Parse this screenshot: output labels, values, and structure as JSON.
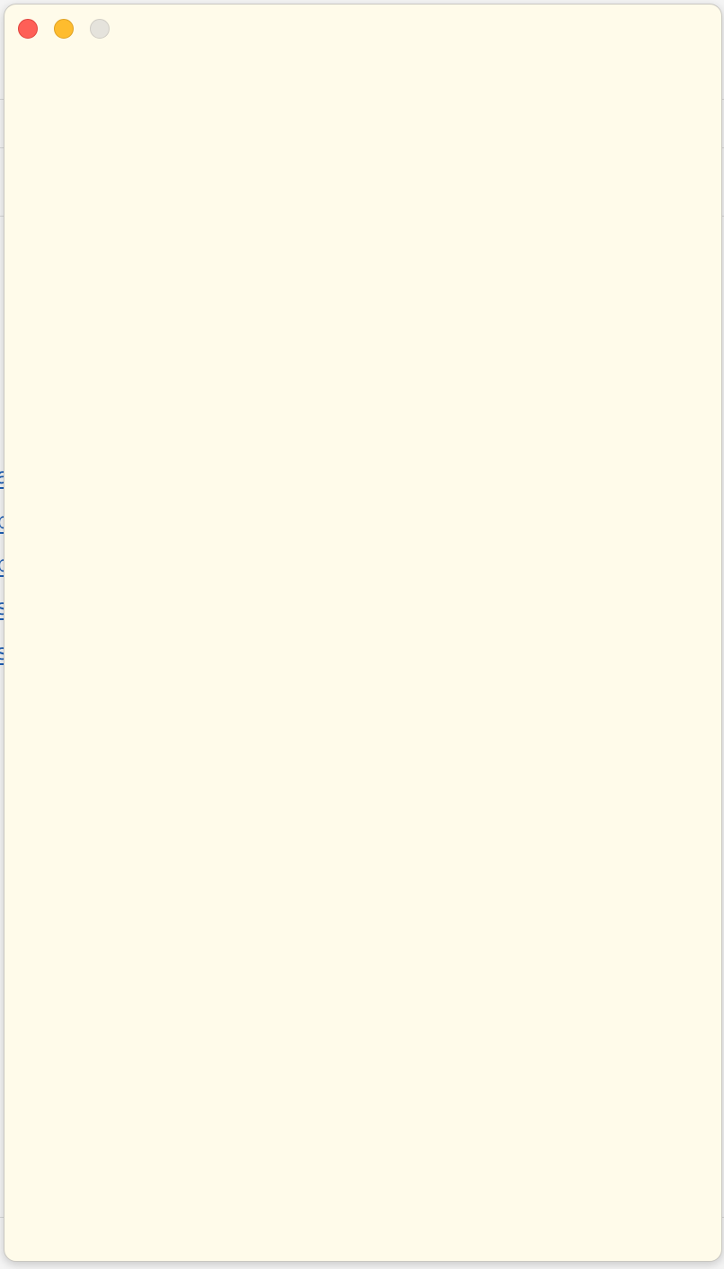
{
  "window": {
    "background": "#fffbea",
    "controls": [
      {
        "name": "close",
        "color": "#fe5f57"
      },
      {
        "name": "minimize",
        "color": "#febc2e"
      },
      {
        "name": "zoom",
        "color": "#e5e3dc"
      }
    ]
  },
  "background_page": {
    "link_color": "#1e5fb4",
    "link_fragments": [
      "a",
      "p",
      "p",
      "s",
      "s"
    ]
  }
}
